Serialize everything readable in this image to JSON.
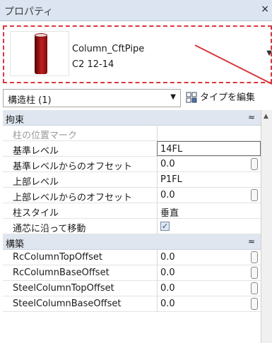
{
  "window": {
    "title": "プロパティ",
    "close_glyph": "×"
  },
  "type_selector": {
    "family_name": "Column_CftPipe",
    "type_name": "C2 12-14",
    "dropdown_glyph": "▼",
    "highlight_color": "#d9363e"
  },
  "instance_selector": {
    "value": "構造柱 (1)",
    "dropdown_glyph": "▼"
  },
  "edit_type_button": {
    "label": "タイプを編集",
    "icon": "edit-type-icon"
  },
  "groups": [
    {
      "label": "拘束",
      "collapse_glyph": "≈",
      "rows": [
        {
          "name": "柱の位置マーク",
          "value": ""
        },
        {
          "name": "基準レベル",
          "value": "14FL"
        },
        {
          "name": "基準レベルからのオフセット",
          "value": "0.0"
        },
        {
          "name": "上部レベル",
          "value": "P1FL"
        },
        {
          "name": "上部レベルからのオフセット",
          "value": "0.0"
        },
        {
          "name": "柱スタイル",
          "value": "垂直"
        },
        {
          "name": "通芯に沿って移動",
          "value": "✓"
        }
      ]
    },
    {
      "label": "構築",
      "collapse_glyph": "≈",
      "rows": [
        {
          "name": "RcColumnTopOffset",
          "value": "0.0"
        },
        {
          "name": "RcColumnBaseOffset",
          "value": "0.0"
        },
        {
          "name": "SteelColumnTopOffset",
          "value": "0.0"
        },
        {
          "name": "SteelColumnBaseOffset",
          "value": "0.0"
        }
      ]
    }
  ],
  "scrollbar": {
    "up_glyph": "▲"
  }
}
